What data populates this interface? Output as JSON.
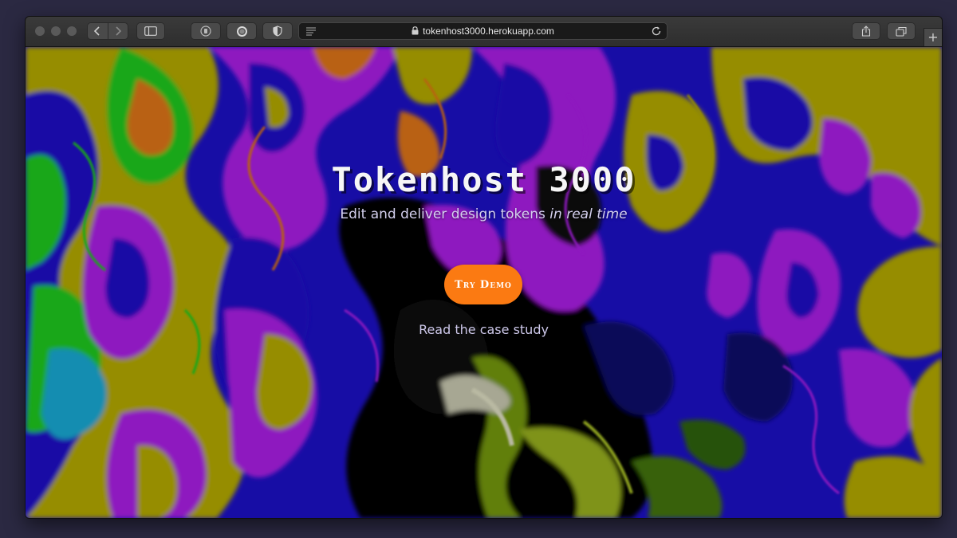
{
  "browser": {
    "url": "tokenhost3000.herokuapp.com",
    "new_tab_label": "+"
  },
  "page": {
    "title": "Tokenhost 3000",
    "subtitle_prefix": "Edit and deliver design tokens ",
    "subtitle_emphasis": "in real time",
    "cta_label": "Try Demo",
    "secondary_link": "Read the case study"
  },
  "colors": {
    "cta": "#fb7a12",
    "desktop": "#2b2942",
    "swirl_yellow": "#a39a00",
    "swirl_blue": "#1a0fb4",
    "swirl_purple": "#9b1bd0",
    "swirl_green": "#1fb61a",
    "swirl_orange": "#c96a12"
  },
  "icons": {
    "back": "chevron-left-icon",
    "forward": "chevron-right-icon",
    "sidebar": "sidebar-icon",
    "privacy": "privacy-report-icon",
    "shield": "shield-icon",
    "reader": "reader-icon",
    "lock": "lock-icon",
    "reload": "reload-icon",
    "share": "share-icon",
    "tabs": "tab-overview-icon"
  }
}
